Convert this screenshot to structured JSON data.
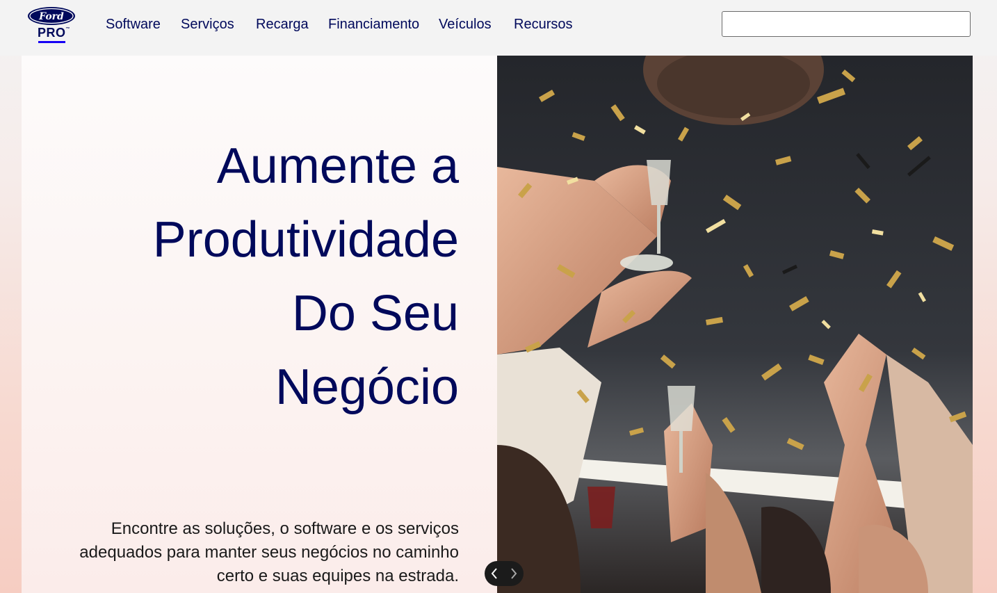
{
  "header": {
    "logo": {
      "brand": "Ford",
      "sub_brand": "PRO",
      "trademark": "™",
      "brand_color": "#00095b",
      "underline_color": "#1700f4"
    },
    "nav": [
      {
        "label": "Software"
      },
      {
        "label": "Serviços"
      },
      {
        "label": "Recarga"
      },
      {
        "label": "Financiamento"
      },
      {
        "label": "Veículos"
      },
      {
        "label": "Recursos"
      }
    ],
    "search": {
      "value": "",
      "placeholder": ""
    }
  },
  "hero": {
    "title_lines": [
      "Aumente a",
      "Produtividade",
      "Do Seu",
      "Negócio"
    ],
    "description": "Encontre as soluções, o software e os serviços adequados para manter seus negócios no caminho certo e suas equipes na estrada.",
    "title_color": "#00095b",
    "image": {
      "subject": "celebration-confetti-champagne-toast"
    },
    "carousel": {
      "prev_icon": "chevron-left-icon",
      "next_icon": "chevron-right-icon"
    }
  }
}
